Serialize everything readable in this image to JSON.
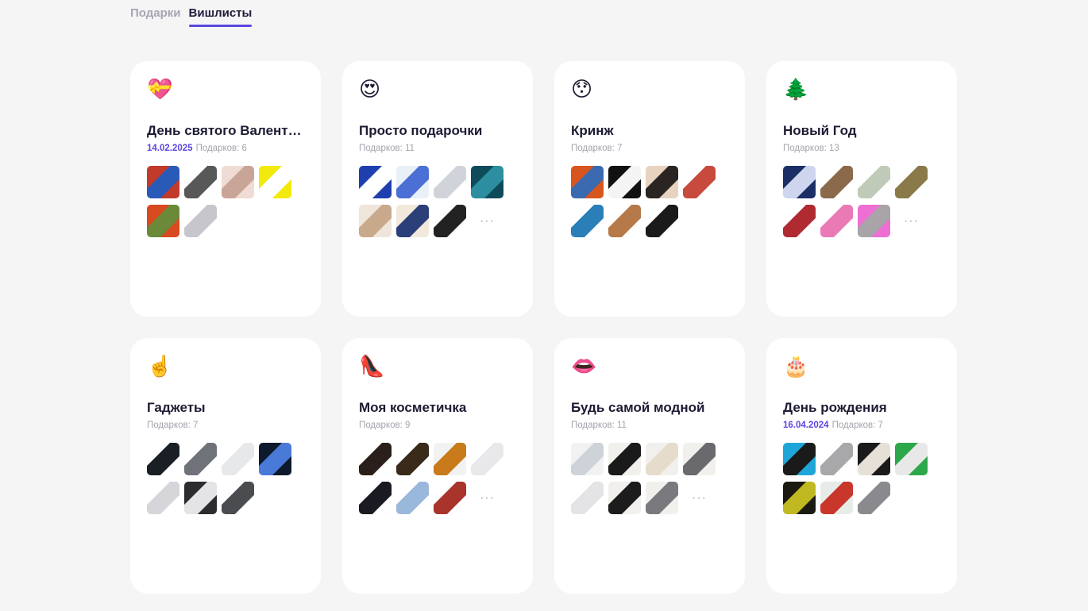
{
  "tabs": [
    {
      "label": "Подарки",
      "active": false
    },
    {
      "label": "Вишлисты",
      "active": true
    }
  ],
  "cards": [
    {
      "emoji": "💝",
      "title": "День святого Валент…",
      "date": "14.02.2025",
      "count_label": "Подарков: 6",
      "thumbs": [
        {
          "name": "books-thumb",
          "colors": [
            "#c23a2c",
            "#2a5ab8"
          ]
        },
        {
          "name": "hair-dryer-thumb",
          "colors": [
            "#ffffff",
            "#585858"
          ]
        },
        {
          "name": "makeup-palette-thumb",
          "colors": [
            "#f0dcd4",
            "#c9a597"
          ]
        },
        {
          "name": "gift-card-thumb",
          "colors": [
            "#f2ea0c",
            "#ffffff"
          ]
        },
        {
          "name": "flowers-thumb",
          "colors": [
            "#d84a1f",
            "#6a8a3a"
          ]
        },
        {
          "name": "ring-thumb",
          "colors": [
            "#ffffff",
            "#c6c6cc"
          ]
        }
      ],
      "more": false
    },
    {
      "emoji": "😍",
      "title": "Просто подарочки",
      "date": "",
      "count_label": "Подарков: 11",
      "thumbs": [
        {
          "name": "blue-card-thumb",
          "colors": [
            "#1f3fae",
            "#ffffff"
          ]
        },
        {
          "name": "toothpaste-thumb",
          "colors": [
            "#eaf0f8",
            "#4b6fd4"
          ]
        },
        {
          "name": "clover-thumb",
          "colors": [
            "#ffffff",
            "#d0d4da"
          ]
        },
        {
          "name": "teal-card-thumb",
          "colors": [
            "#0e4b5a",
            "#2c8ea0"
          ]
        },
        {
          "name": "cosmetics-set-thumb",
          "colors": [
            "#efe5da",
            "#c9a98c"
          ]
        },
        {
          "name": "bottles-thumb",
          "colors": [
            "#f2e9dc",
            "#2b3f78"
          ]
        },
        {
          "name": "perfume-thumb",
          "colors": [
            "#ffffff",
            "#222222"
          ]
        }
      ],
      "more": true,
      "more_label": "···"
    },
    {
      "emoji": "😯",
      "title": "Кринж",
      "date": "",
      "count_label": "Подарков: 7",
      "thumbs": [
        {
          "name": "orange-rug-thumb",
          "colors": [
            "#d9551f",
            "#3b6ab0"
          ]
        },
        {
          "name": "tooth-thumb",
          "colors": [
            "#111111",
            "#f4f4f4"
          ]
        },
        {
          "name": "portrait-thumb",
          "colors": [
            "#e8d3c0",
            "#2a2422"
          ]
        },
        {
          "name": "sail-thumb",
          "colors": [
            "#ffffff",
            "#c84a3c"
          ]
        },
        {
          "name": "tote-bag-thumb",
          "colors": [
            "#ffffff",
            "#2a7fb8"
          ]
        },
        {
          "name": "wicker-bag-thumb",
          "colors": [
            "#ffffff",
            "#b5794a"
          ]
        },
        {
          "name": "puffin-thumb",
          "colors": [
            "#ffffff",
            "#1a1a1a"
          ]
        }
      ],
      "more": false
    },
    {
      "emoji": "🌲",
      "title": "Новый Год",
      "date": "",
      "count_label": "Подарков: 13",
      "thumbs": [
        {
          "name": "navy-print-thumb",
          "colors": [
            "#1c2e66",
            "#cdd6ee"
          ]
        },
        {
          "name": "jars-thumb",
          "colors": [
            "#ffffff",
            "#8a6a4a"
          ]
        },
        {
          "name": "pitcher-thumb",
          "colors": [
            "#ffffff",
            "#bfcab8"
          ]
        },
        {
          "name": "pillow-thumb",
          "colors": [
            "#ffffff",
            "#8a7a4a"
          ]
        },
        {
          "name": "lipstick-thumb",
          "colors": [
            "#ffffff",
            "#b02a32"
          ]
        },
        {
          "name": "pink-bottle-thumb",
          "colors": [
            "#ffffff",
            "#ea7ab5"
          ]
        },
        {
          "name": "pink-card-thumb",
          "colors": [
            "#ee6fd3",
            "#a9a4a8"
          ]
        }
      ],
      "more": true,
      "more_label": "···"
    },
    {
      "emoji": "☝️",
      "title": "Гаджеты",
      "date": "",
      "count_label": "Подарков: 7",
      "thumbs": [
        {
          "name": "power-bank-thumb",
          "colors": [
            "#ffffff",
            "#1a1f26"
          ]
        },
        {
          "name": "headphones-thumb",
          "colors": [
            "#ffffff",
            "#6f7278"
          ]
        },
        {
          "name": "scale-thumb",
          "colors": [
            "#ffffff",
            "#e6e8ea"
          ]
        },
        {
          "name": "lamp-thumb",
          "colors": [
            "#0d1a2c",
            "#4a7ad8"
          ]
        },
        {
          "name": "robot-vacuum-thumb",
          "colors": [
            "#ffffff",
            "#d6d6da"
          ]
        },
        {
          "name": "earbuds-thumb",
          "colors": [
            "#2c2c30",
            "#e4e4e6"
          ]
        },
        {
          "name": "phone-thumb",
          "colors": [
            "#ffffff",
            "#4a4c50"
          ]
        }
      ],
      "more": false
    },
    {
      "emoji": "👠",
      "title": "Моя косметичка",
      "date": "",
      "count_label": "Подарков: 9",
      "thumbs": [
        {
          "name": "dark-serum-thumb",
          "colors": [
            "#ffffff",
            "#2a1f1a"
          ]
        },
        {
          "name": "tom-ford-thumb",
          "colors": [
            "#ffffff",
            "#3a2a1a"
          ]
        },
        {
          "name": "amber-bottle-thumb",
          "colors": [
            "#f2f2f2",
            "#c97a1a"
          ]
        },
        {
          "name": "white-tube-thumb",
          "colors": [
            "#ffffff",
            "#e8e8ea"
          ]
        },
        {
          "name": "mascara-thumb",
          "colors": [
            "#ffffff",
            "#1a1a22"
          ]
        },
        {
          "name": "blue-tube-thumb",
          "colors": [
            "#ffffff",
            "#9ab7dc"
          ]
        },
        {
          "name": "serum-box-thumb",
          "colors": [
            "#ffffff",
            "#a8342c"
          ]
        }
      ],
      "more": true,
      "more_label": "···"
    },
    {
      "emoji": "👄",
      "title": "Будь самой модной",
      "date": "",
      "count_label": "Подарков: 11",
      "thumbs": [
        {
          "name": "sweatshirt-thumb",
          "colors": [
            "#f2f2f2",
            "#cdd3d8"
          ]
        },
        {
          "name": "black-dress-thumb",
          "colors": [
            "#f2f0ec",
            "#1a1a1a"
          ]
        },
        {
          "name": "cream-outfit-thumb",
          "colors": [
            "#f2f0ec",
            "#e6dccb"
          ]
        },
        {
          "name": "grey-sweater-thumb",
          "colors": [
            "#f2f0ec",
            "#6a6a6e"
          ]
        },
        {
          "name": "sneakers-thumb",
          "colors": [
            "#ffffff",
            "#e4e4e6"
          ]
        },
        {
          "name": "black-mini-dress-thumb",
          "colors": [
            "#f2f0ec",
            "#1c1c1c"
          ]
        },
        {
          "name": "grey-dress-thumb",
          "colors": [
            "#f2f0ec",
            "#7a7a7e"
          ]
        }
      ],
      "more": true,
      "more_label": "···"
    },
    {
      "emoji": "🎂",
      "title": "День рождения",
      "date": "16.04.2024",
      "count_label": "Подарков: 7",
      "thumbs": [
        {
          "name": "blue-book-thumb",
          "colors": [
            "#1fa6d8",
            "#1a1a1a"
          ]
        },
        {
          "name": "car-model-thumb",
          "colors": [
            "#ffffff",
            "#a8a8aa"
          ]
        },
        {
          "name": "actress-poster-thumb",
          "colors": [
            "#1a1a1a",
            "#e6e0d8"
          ]
        },
        {
          "name": "green-book-thumb",
          "colors": [
            "#2ca84a",
            "#e8e8e8"
          ]
        },
        {
          "name": "dark-book-thumb",
          "colors": [
            "#1a1a12",
            "#c0b820"
          ]
        },
        {
          "name": "monopoly-thumb",
          "colors": [
            "#e8ece8",
            "#c8362c"
          ]
        },
        {
          "name": "toaster-thumb",
          "colors": [
            "#ffffff",
            "#8a8a8e"
          ]
        }
      ],
      "more": false
    }
  ]
}
